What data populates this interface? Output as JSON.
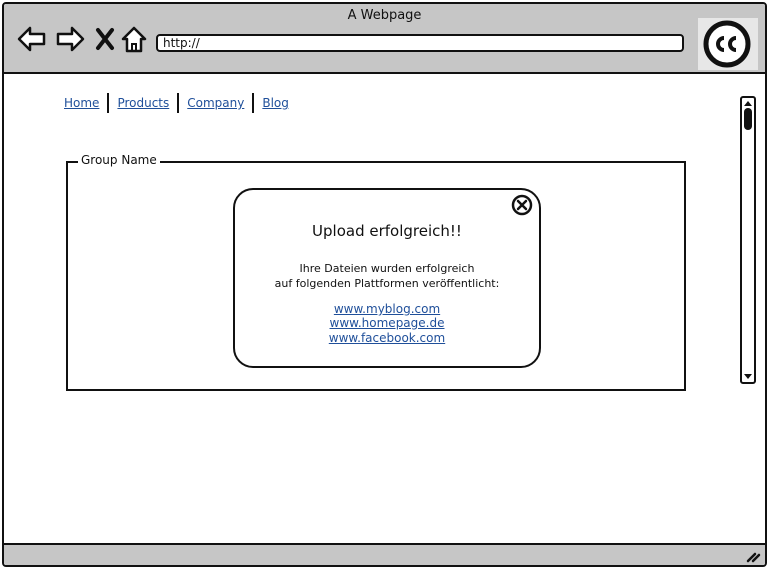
{
  "window": {
    "title": "A Webpage",
    "url": "http://"
  },
  "nav": {
    "home": "Home",
    "products": "Products",
    "company": "Company",
    "blog": "Blog"
  },
  "group": {
    "label": "Group Name"
  },
  "dialog": {
    "title": "Upload erfolgreich!!",
    "line1": "Ihre Dateien wurden erfolgreich",
    "line2": "auf folgenden Plattformen veröffentlicht:",
    "links": [
      "www.myblog.com",
      "www.homepage.de",
      "www.facebook.com"
    ]
  },
  "icons": {
    "back": "back-arrow-icon",
    "forward": "forward-arrow-icon",
    "stop": "close-x-icon",
    "home": "home-icon",
    "logo": "creative-commons-icon",
    "dialog_close": "close-circle-icon",
    "resize": "resize-grip-icon"
  },
  "colors": {
    "link": "#1f4f9a",
    "chrome": "#c6c6c6"
  }
}
